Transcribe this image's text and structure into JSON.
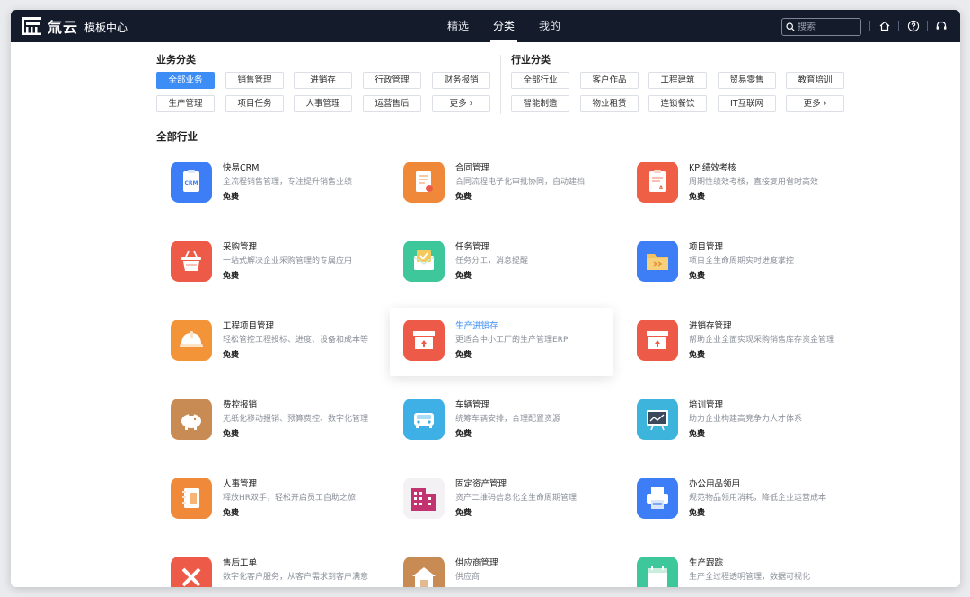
{
  "header": {
    "brand": "氚云",
    "app_title": "模板中心",
    "nav": [
      "精选",
      "分类",
      "我的"
    ],
    "nav_active": "分类",
    "search_placeholder": "搜索"
  },
  "business": {
    "title": "业务分类",
    "chips": [
      "全部业务",
      "销售管理",
      "进销存",
      "行政管理",
      "财务报销",
      "生产管理",
      "项目任务",
      "人事管理",
      "运营售后",
      "更多 ›"
    ],
    "active": "全部业务"
  },
  "industry": {
    "title": "行业分类",
    "chips": [
      "全部行业",
      "客户作品",
      "工程建筑",
      "贸易零售",
      "教育培训",
      "智能制造",
      "物业租赁",
      "连锁餐饮",
      "IT互联网",
      "更多 ›"
    ]
  },
  "list_title": "全部行业",
  "cards": [
    {
      "title": "快易CRM",
      "desc": "全流程销售管理，专注提升销售业绩",
      "price": "免费",
      "icon": "crm-icon",
      "color": "#3d7ef6"
    },
    {
      "title": "合同管理",
      "desc": "合同流程电子化审批协同，自动建档",
      "price": "免费",
      "icon": "contract-icon",
      "color": "#f0883a"
    },
    {
      "title": "KPI绩效考核",
      "desc": "周期性绩效考核，直接复用省时高效",
      "price": "免费",
      "icon": "kpi-icon",
      "color": "#ee5f45"
    },
    {
      "title": "采购管理",
      "desc": "一站式解决企业采购管理的专属应用",
      "price": "免费",
      "icon": "basket-icon",
      "color": "#ee5a48"
    },
    {
      "title": "任务管理",
      "desc": "任务分工，消息提醒",
      "price": "免费",
      "icon": "task-mail-icon",
      "color": "#3ec79a"
    },
    {
      "title": "项目管理",
      "desc": "项目全生命周期实时进度掌控",
      "price": "免费",
      "icon": "folder-icon",
      "color": "#3d7ef6"
    },
    {
      "title": "工程项目管理",
      "desc": "轻松管控工程投标、进度、设备和成本等",
      "price": "免费",
      "icon": "helmet-icon",
      "color": "#f39438"
    },
    {
      "title": "生产进销存",
      "desc": "更适合中小工厂的生产管理ERP",
      "price": "免费",
      "icon": "box-icon",
      "color": "#ee5a48"
    },
    {
      "title": "进销存管理",
      "desc": "帮助企业全面实现采购销售库存资金管理",
      "price": "免费",
      "icon": "box-icon",
      "color": "#ee5a48"
    },
    {
      "title": "费控报销",
      "desc": "无纸化移动报销、预算费控、数字化管理",
      "price": "免费",
      "icon": "piggy-bank-icon",
      "color": "#c98b54"
    },
    {
      "title": "车辆管理",
      "desc": "统筹车辆安排，合理配置资源",
      "price": "免费",
      "icon": "car-icon",
      "color": "#3eb0e6"
    },
    {
      "title": "培训管理",
      "desc": "助力企业构建高竞争力人才体系",
      "price": "免费",
      "icon": "presentation-icon",
      "color": "#3cb4dc"
    },
    {
      "title": "人事管理",
      "desc": "释放HR双手，轻松开启员工自助之旅",
      "price": "免费",
      "icon": "notebook-icon",
      "color": "#f08a3a"
    },
    {
      "title": "固定资产管理",
      "desc": "资产二维码信息化全生命周期管理",
      "price": "免费",
      "icon": "building-icon",
      "color": "#f3f1f4"
    },
    {
      "title": "办公用品领用",
      "desc": "规范物品领用消耗，降低企业运营成本",
      "price": "免费",
      "icon": "printer-icon",
      "color": "#3d7ef6"
    },
    {
      "title": "售后工单",
      "desc": "数字化客户服务，从客户需求到客户满意",
      "price": "",
      "icon": "tools-icon",
      "color": "#ee5a48"
    },
    {
      "title": "供应商管理",
      "desc": "供应商",
      "price": "",
      "icon": "warehouse-icon",
      "color": "#c98b54"
    },
    {
      "title": "生产跟踪",
      "desc": "生产全过程透明管理，数据可视化",
      "price": "",
      "icon": "calendar-icon",
      "color": "#3ec79a"
    }
  ]
}
